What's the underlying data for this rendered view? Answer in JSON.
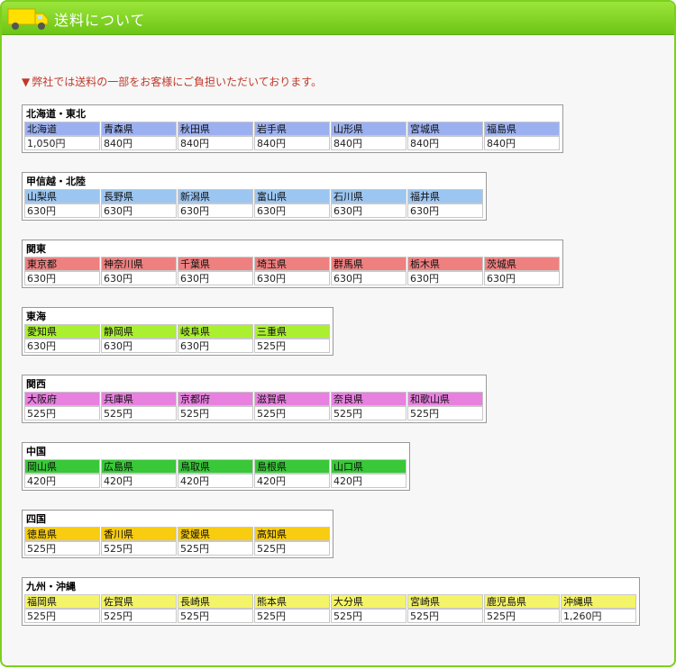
{
  "header": {
    "title": "送料について"
  },
  "notice": {
    "marker": "▼",
    "text": "弊社では送料の一部をお客様にご負担いただいております。"
  },
  "regions": [
    {
      "name": "北海道・東北",
      "color": "#9bb0f0",
      "prefectures": [
        "北海道",
        "青森県",
        "秋田県",
        "岩手県",
        "山形県",
        "宮城県",
        "福島県"
      ],
      "prices": [
        "1,050円",
        "840円",
        "840円",
        "840円",
        "840円",
        "840円",
        "840円"
      ]
    },
    {
      "name": "甲信越・北陸",
      "color": "#9cc6f2",
      "prefectures": [
        "山梨県",
        "長野県",
        "新潟県",
        "富山県",
        "石川県",
        "福井県"
      ],
      "prices": [
        "630円",
        "630円",
        "630円",
        "630円",
        "630円",
        "630円"
      ]
    },
    {
      "name": "関東",
      "color": "#ef8080",
      "prefectures": [
        "東京都",
        "神奈川県",
        "千葉県",
        "埼玉県",
        "群馬県",
        "栃木県",
        "茨城県"
      ],
      "prices": [
        "630円",
        "630円",
        "630円",
        "630円",
        "630円",
        "630円",
        "630円"
      ]
    },
    {
      "name": "東海",
      "color": "#aaf030",
      "prefectures": [
        "愛知県",
        "静岡県",
        "岐阜県",
        "三重県"
      ],
      "prices": [
        "630円",
        "630円",
        "630円",
        "525円"
      ]
    },
    {
      "name": "関西",
      "color": "#e880e0",
      "prefectures": [
        "大阪府",
        "兵庫県",
        "京都府",
        "滋賀県",
        "奈良県",
        "和歌山県"
      ],
      "prices": [
        "525円",
        "525円",
        "525円",
        "525円",
        "525円",
        "525円"
      ]
    },
    {
      "name": "中国",
      "color": "#38c838",
      "prefectures": [
        "岡山県",
        "広島県",
        "鳥取県",
        "島根県",
        "山口県"
      ],
      "prices": [
        "420円",
        "420円",
        "420円",
        "420円",
        "420円"
      ]
    },
    {
      "name": "四国",
      "color": "#f8cc10",
      "prefectures": [
        "徳島県",
        "香川県",
        "愛媛県",
        "高知県"
      ],
      "prices": [
        "525円",
        "525円",
        "525円",
        "525円"
      ]
    },
    {
      "name": "九州・沖縄",
      "color": "#f4f468",
      "prefectures": [
        "福岡県",
        "佐賀県",
        "長崎県",
        "熊本県",
        "大分県",
        "宮崎県",
        "鹿児島県",
        "沖縄県"
      ],
      "prices": [
        "525円",
        "525円",
        "525円",
        "525円",
        "525円",
        "525円",
        "525円",
        "1,260円"
      ]
    }
  ]
}
